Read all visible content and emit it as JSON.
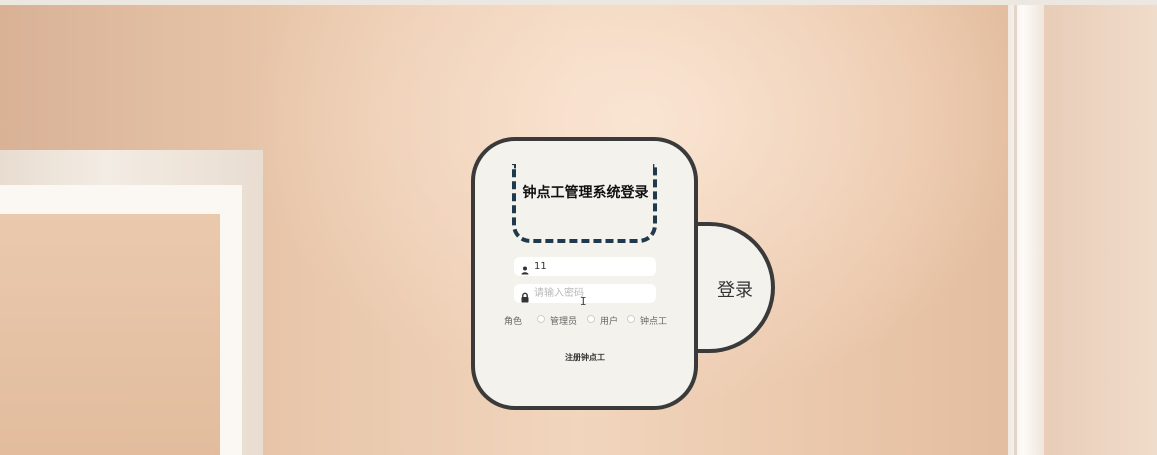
{
  "login": {
    "title": "钟点工管理系统登录",
    "username": {
      "value": "11"
    },
    "password": {
      "placeholder": "请输入密码",
      "value": ""
    },
    "role": {
      "label": "角色",
      "options": [
        "管理员",
        "用户",
        "钟点工"
      ]
    },
    "submit_label": "登录",
    "register_label": "注册钟点工"
  },
  "icons": {
    "user": "user-icon",
    "password": "lock-icon"
  }
}
